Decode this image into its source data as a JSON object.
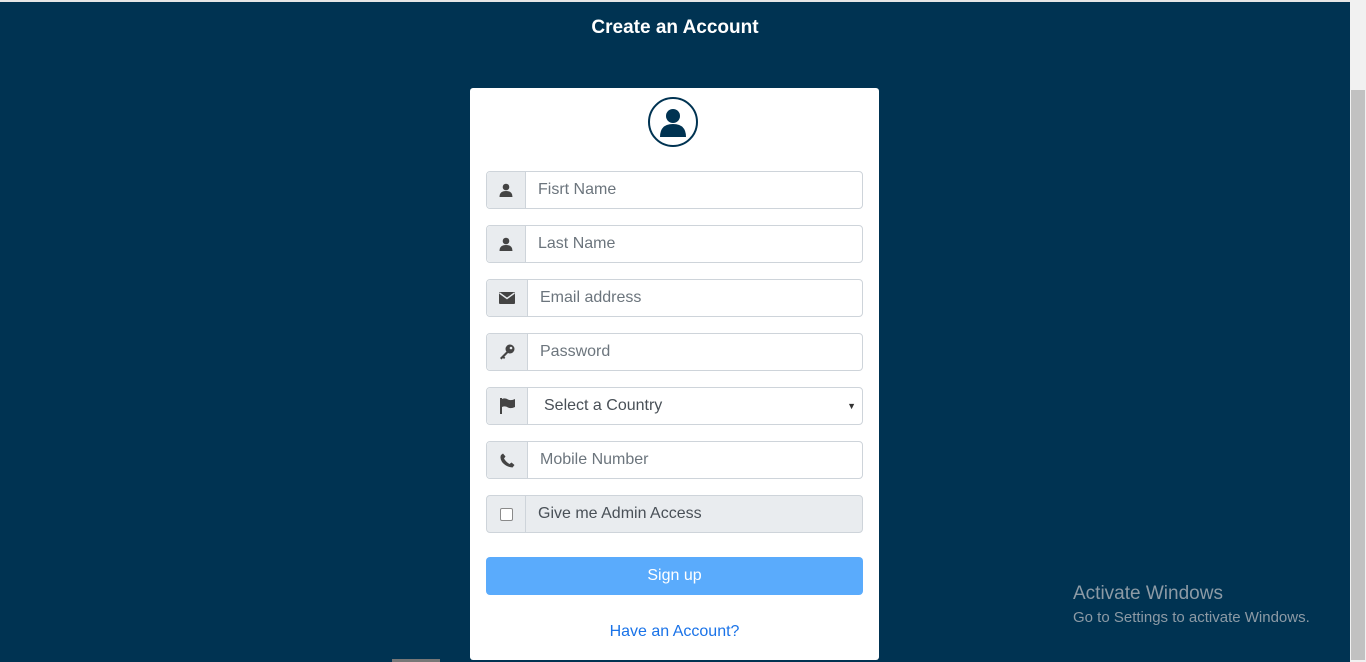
{
  "header": {
    "title": "Create an Account"
  },
  "form": {
    "avatar_icon": "user-circle-icon",
    "first_name": {
      "placeholder": "Fisrt Name",
      "icon": "user-icon"
    },
    "last_name": {
      "placeholder": "Last Name",
      "icon": "user-icon"
    },
    "email": {
      "placeholder": "Email address",
      "icon": "envelope-icon"
    },
    "password": {
      "placeholder": "Password",
      "icon": "key-icon"
    },
    "country": {
      "selected": "Select a Country",
      "icon": "flag-icon"
    },
    "mobile": {
      "placeholder": "Mobile Number",
      "icon": "phone-icon"
    },
    "admin_access": {
      "label": "Give me Admin Access",
      "checked": false
    },
    "signup_label": "Sign up",
    "have_account_label": "Have an Account?"
  },
  "watermark": {
    "line1": "Activate Windows",
    "line2": "Go to Settings to activate Windows."
  },
  "colors": {
    "background": "#003352",
    "button": "#5aabfc",
    "link": "#1a73e8"
  }
}
